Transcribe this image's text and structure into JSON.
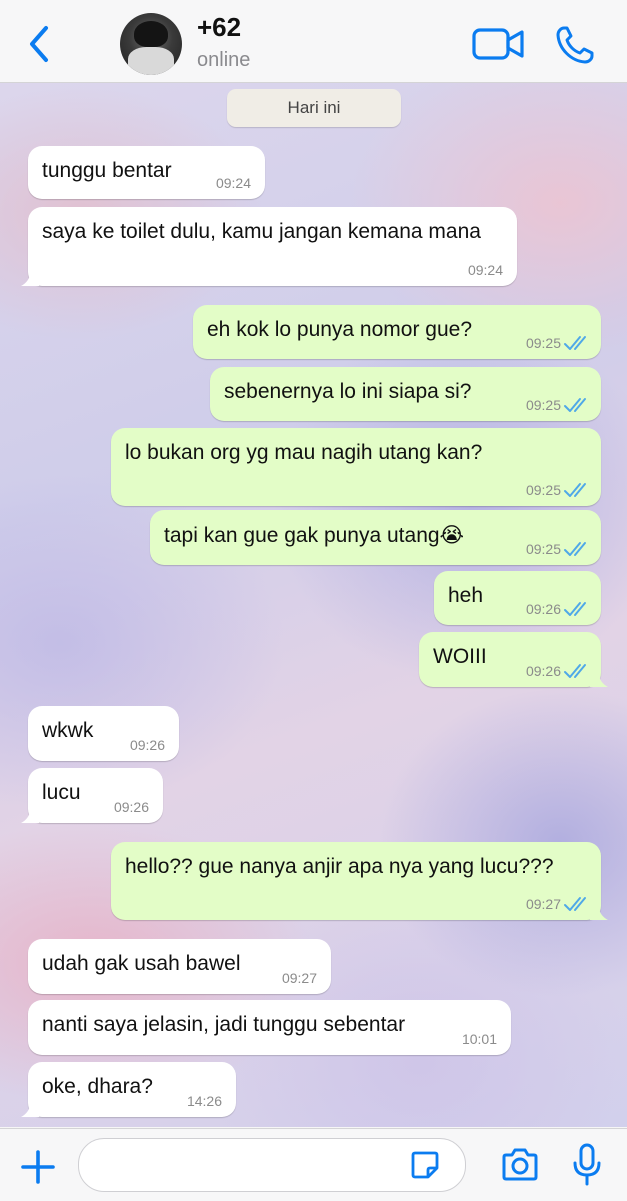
{
  "header": {
    "contact_name": "+62",
    "status": "online"
  },
  "chat": {
    "date_chip": "Hari ini",
    "messages": [
      {
        "dir": "in",
        "text": "tunggu bentar",
        "time": "09:24"
      },
      {
        "dir": "in",
        "text": "saya ke toilet dulu, kamu jangan kemana mana",
        "time": "09:24"
      },
      {
        "dir": "out",
        "text": "eh kok lo punya nomor gue?",
        "time": "09:25",
        "status": "read"
      },
      {
        "dir": "out",
        "text": "sebenernya lo ini siapa si?",
        "time": "09:25",
        "status": "read"
      },
      {
        "dir": "out",
        "text": "lo bukan org yg mau nagih utang kan?",
        "time": "09:25",
        "status": "read"
      },
      {
        "dir": "out",
        "text": "tapi kan gue gak punya utang😭",
        "time": "09:25",
        "status": "read"
      },
      {
        "dir": "out",
        "text": "heh",
        "time": "09:26",
        "status": "read"
      },
      {
        "dir": "out",
        "text": "WOIII",
        "time": "09:26",
        "status": "read"
      },
      {
        "dir": "in",
        "text": "wkwk",
        "time": "09:26"
      },
      {
        "dir": "in",
        "text": "lucu",
        "time": "09:26"
      },
      {
        "dir": "out",
        "text": "hello?? gue nanya anjir apa nya yang lucu???",
        "time": "09:27",
        "status": "read"
      },
      {
        "dir": "in",
        "text": "udah gak usah bawel",
        "time": "09:27"
      },
      {
        "dir": "in",
        "text": "nanti saya jelasin, jadi tunggu sebentar",
        "time": "10:01"
      },
      {
        "dir": "in",
        "text": "oke, dhara?",
        "time": "14:26"
      }
    ]
  },
  "input": {
    "placeholder": "",
    "value": ""
  },
  "icons": {
    "back": "chevron-left-icon",
    "video": "video-camera-icon",
    "call": "phone-icon",
    "plus": "plus-icon",
    "sticker": "sticker-icon",
    "camera": "camera-icon",
    "mic": "microphone-icon"
  },
  "colors": {
    "accent": "#0b7cf0",
    "outgoing_bubble": "#e3fdc7",
    "incoming_bubble": "#ffffff",
    "read_ticks": "#4fa8e8"
  }
}
